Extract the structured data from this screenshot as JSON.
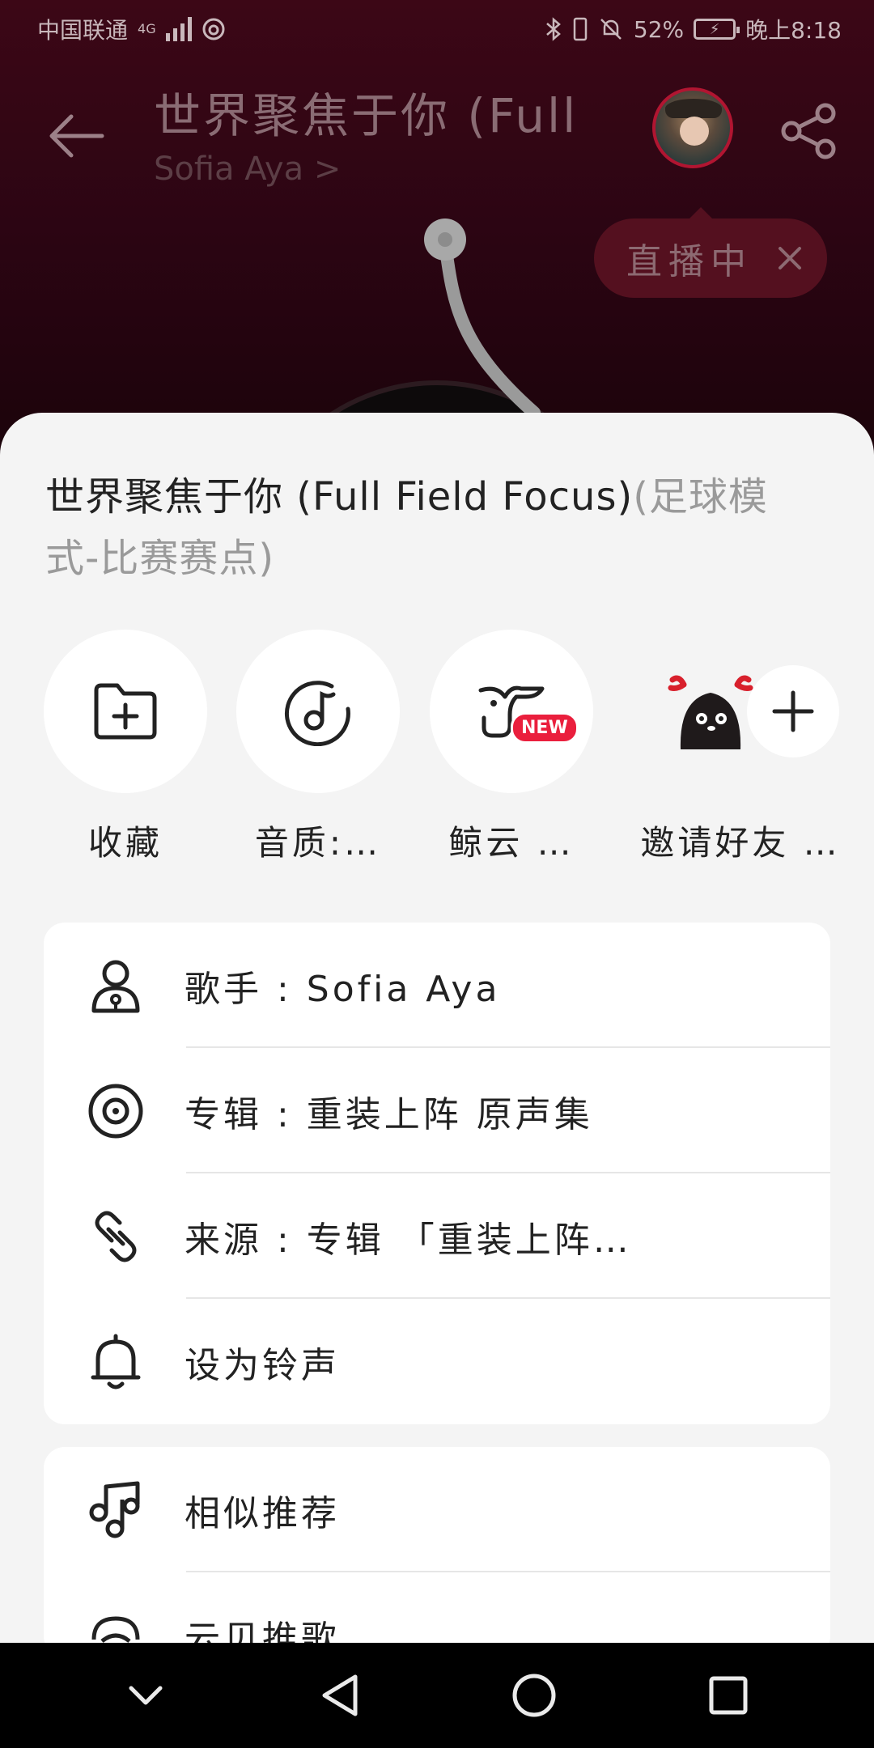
{
  "status_bar": {
    "carrier": "中国联通",
    "network": "4G",
    "battery": "52%",
    "time": "晚上8:18"
  },
  "player": {
    "song_title": "世界聚焦于你 (Full",
    "artist": "Sofia Aya >",
    "live_label": "直播中"
  },
  "sheet": {
    "title_main": "世界聚焦于你 (Full Field Focus)",
    "title_sub": "(足球模式-比赛赛点)",
    "quick_actions": [
      {
        "label": "收藏",
        "icon": "folder-plus-icon"
      },
      {
        "label": "音质:…",
        "icon": "music-note-circle-icon"
      },
      {
        "label": "鲸云 …",
        "icon": "whale-icon",
        "badge": "NEW"
      },
      {
        "label": "邀请好友 …",
        "icon": "plus-icon"
      }
    ],
    "info_rows": [
      {
        "label": "歌手 : Sofia Aya",
        "icon": "singer-icon"
      },
      {
        "label": "专辑 : 重装上阵 原声集",
        "icon": "album-icon"
      },
      {
        "label": "来源 : 专辑 「重装上阵…",
        "icon": "link-icon"
      },
      {
        "label": "设为铃声",
        "icon": "bell-icon"
      }
    ],
    "rec_rows": [
      {
        "label": "相似推荐",
        "icon": "music-notes-icon"
      },
      {
        "label": "云贝推歌",
        "icon": "cloud-coin-icon"
      }
    ]
  },
  "colors": {
    "accent_red": "#ea1f3d",
    "player_bg": "#2c0513",
    "sheet_bg": "#f4f4f4"
  }
}
